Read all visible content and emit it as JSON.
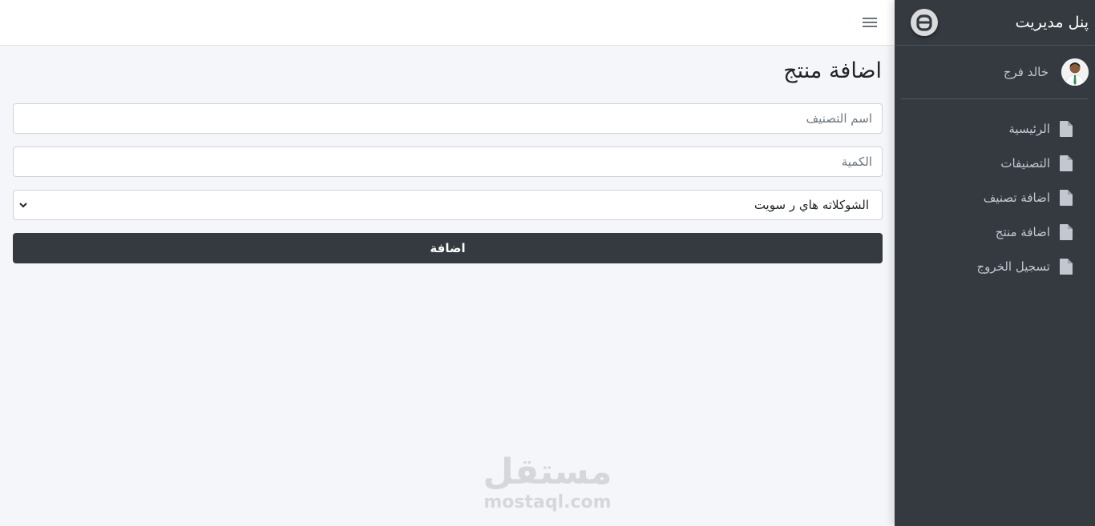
{
  "sidebar": {
    "brand_text": "پنل مدیریت",
    "user_name": "خالد فرج",
    "items": [
      {
        "label": "الرئيسية"
      },
      {
        "label": "التصنيفات"
      },
      {
        "label": "اضافة تصنيف"
      },
      {
        "label": "اضافة منتج"
      },
      {
        "label": "تسجيل الخروج"
      }
    ]
  },
  "main": {
    "title": "اضافة منتج",
    "category_name_placeholder": "اسم التصنيف",
    "quantity_placeholder": "الكمية",
    "select_value": "الشوكلاته هاي ر سويت",
    "submit_label": "اضافة"
  },
  "watermark": {
    "arabic": "مستقل",
    "latin": "mostaql.com"
  },
  "colors": {
    "sidebar_bg": "#343a40",
    "button_bg": "#343a40",
    "page_bg": "#f4f6f9"
  },
  "icons": {
    "menu": "hamburger-icon",
    "nav": "file-icon",
    "select": "chevron-down-icon"
  }
}
